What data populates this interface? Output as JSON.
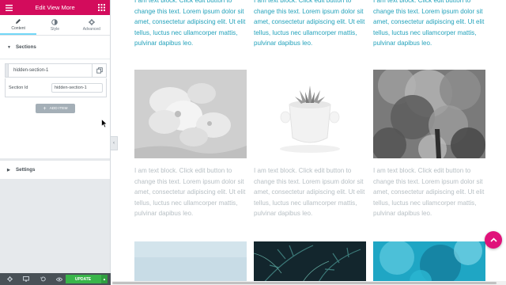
{
  "panel": {
    "title": "Edit View More",
    "tabs": [
      {
        "label": "Content",
        "icon": "pencil-icon"
      },
      {
        "label": "Style",
        "icon": "contrast-icon"
      },
      {
        "label": "Advanced",
        "icon": "gear-icon"
      }
    ],
    "sections_title": "Sections",
    "repeater_item": "hidden-section-1",
    "section_id_label": "Section Id",
    "section_id_value": "hidden-section-1",
    "add_item_label": "ADD ITEM",
    "settings_title": "Settings",
    "update_label": "UPDATE"
  },
  "canvas": {
    "top_texts": [
      "I am text block. Click edit button to change this text. Lorem ipsum dolor sit amet, consectetur adipiscing elit. Ut elit tellus, luctus nec ullamcorper mattis, pulvinar dapibus leo.",
      "I am text block. Click edit button to change this text. Lorem ipsum dolor sit amet, consectetur adipiscing elit. Ut elit tellus, luctus nec ullamcorper mattis, pulvinar dapibus leo.",
      "I am text block. Click edit button to change this text. Lorem ipsum dolor sit amet, consectetur adipiscing elit. Ut elit tellus, luctus nec ullamcorper mattis, pulvinar dapibus leo."
    ],
    "mid_texts": [
      "I am text block. Click edit button to change this text. Lorem ipsum dolor sit amet, consectetur adipiscing elit. Ut elit tellus, luctus nec ullamcorper mattis, pulvinar dapibus leo.",
      "I am text block. Click edit button to change this text. Lorem ipsum dolor sit amet, consectetur adipiscing elit. Ut elit tellus, luctus nec ullamcorper mattis, pulvinar dapibus leo.",
      "I am text block. Click edit button to change this text. Lorem ipsum dolor sit amet, consectetur adipiscing elit. Ut elit tellus, luctus nec ullamcorper mattis, pulvinar dapibus leo."
    ]
  },
  "colors": {
    "brand": "#d30c5c",
    "active_text": "#23a2bb",
    "inactive_text": "#b7bfc4",
    "update_green": "#39b54a",
    "fab_pink": "#e0127a"
  }
}
